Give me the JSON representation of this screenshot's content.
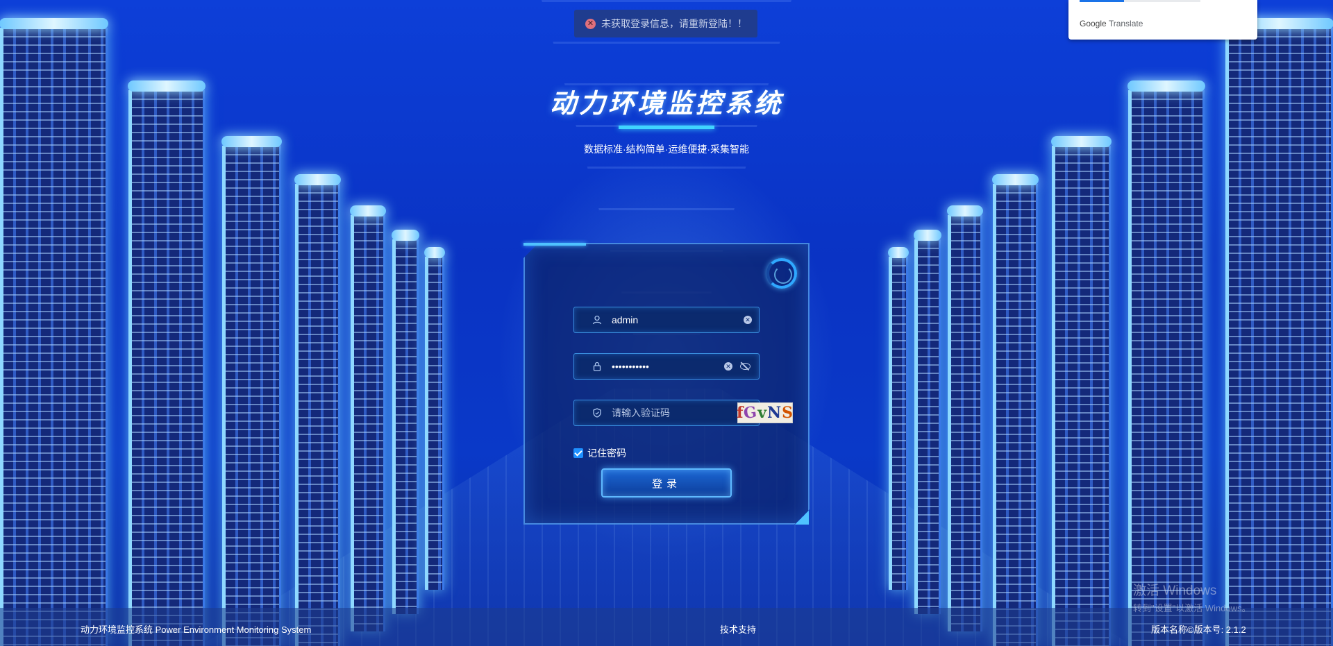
{
  "notification": {
    "message": "未获取登录信息，请重新登陆！！",
    "icon": "error-circle-icon",
    "color": "#e0707c"
  },
  "translate_widget": {
    "brand": "Google",
    "label": "Translate"
  },
  "header": {
    "title": "动力环境监控系统",
    "subtitle": "数据标准·结构简单·运维便捷·采集智能",
    "accent_color": "#3fd4ff"
  },
  "login": {
    "username": {
      "value": "admin",
      "icon": "user-icon"
    },
    "password": {
      "value": "•••••••••••",
      "icon": "lock-icon"
    },
    "captcha": {
      "placeholder": "请输入验证码",
      "image_text": "fGvNS",
      "icon": "shield-icon"
    },
    "remember": {
      "label": "记住密码",
      "checked": true
    },
    "submit_label": "登录"
  },
  "footer": {
    "left": "动力环境监控系统 Power Environment Monitoring System",
    "middle": "技术支持",
    "right": "版本名称©版本号: 2.1.2"
  },
  "watermark": {
    "line1": "激活 Windows",
    "line2": "转到\"设置\"以激活 Windows。"
  }
}
